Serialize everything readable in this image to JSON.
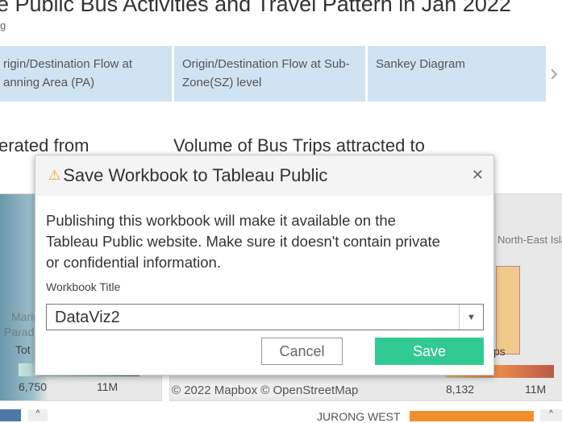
{
  "page": {
    "title": "e Public Bus Activities and Travel Pattern in Jan 2022",
    "subtitle": "g"
  },
  "tabs": [
    {
      "label": "rigin/Destination Flow at anning Area (PA)"
    },
    {
      "label": "Origin/Destination Flow at Sub-Zone(SZ) level"
    },
    {
      "label": "Sankey Diagram"
    }
  ],
  "sections": {
    "left_heading": "erated from",
    "right_heading": "Volume of Bus Trips attracted to"
  },
  "left_map": {
    "legend_title": "Tot",
    "min": "6,750",
    "max": "11M",
    "labels": [
      "Marin",
      "Parad"
    ]
  },
  "right_map": {
    "legend_title": "ps",
    "min": "8,132",
    "max": "11M",
    "labels": [
      "North-East Islands"
    ],
    "attribution": "© 2022 Mapbox © OpenStreetMap"
  },
  "bottom": {
    "label": "JURONG WEST"
  },
  "dialog": {
    "title": "Save Workbook to Tableau Public",
    "message": "Publishing this workbook will make it available on the Tableau Public website. Make sure it doesn't contain private or confidential information.",
    "field_label": "Workbook Title",
    "field_value": "DataViz2",
    "cancel": "Cancel",
    "save": "Save"
  },
  "colors": {
    "save": "#33c995",
    "tab": "#cfe3f2",
    "bar": "#f28e2b"
  }
}
